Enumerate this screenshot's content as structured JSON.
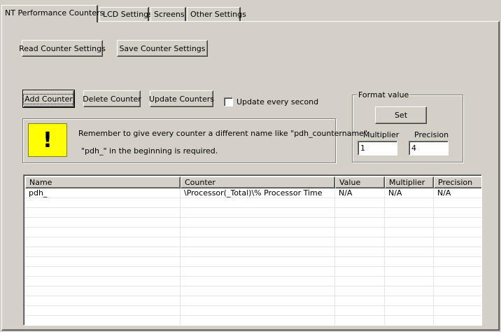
{
  "tabs": [
    {
      "label": "NT Performance Counters",
      "active": true
    },
    {
      "label": "LCD Settings",
      "active": false
    },
    {
      "label": "Screens",
      "active": false
    },
    {
      "label": "Other Settings",
      "active": false
    }
  ],
  "buttons": {
    "read_settings": "Read Counter Settings",
    "save_settings": "Save Counter Settings",
    "add_counter": "Add Counter",
    "delete_counter": "Delete Counter",
    "update_counters": "Update Counters",
    "set": "Set"
  },
  "update_checkbox": {
    "label": "Update every second",
    "checked": false
  },
  "format_value": {
    "legend": "Format value",
    "multiplier_label": "Multiplier",
    "multiplier_value": "1",
    "precision_label": "Precision",
    "precision_value": "4"
  },
  "info": {
    "icon": "exclamation-icon",
    "icon_glyph": "!",
    "line1": "Remember to give every counter a different name like \"pdh_countername\".",
    "line2": "\"pdh_\" in the beginning is required."
  },
  "table": {
    "columns": [
      "Name",
      "Counter",
      "Value",
      "Multiplier",
      "Precision"
    ],
    "rows": [
      [
        "pdh_",
        "\\Processor(_Total)\\% Processor Time",
        "N/A",
        "N/A",
        "N/A"
      ]
    ]
  },
  "colors": {
    "face": "#d4d0c8",
    "warning_yellow": "#ffff00"
  }
}
